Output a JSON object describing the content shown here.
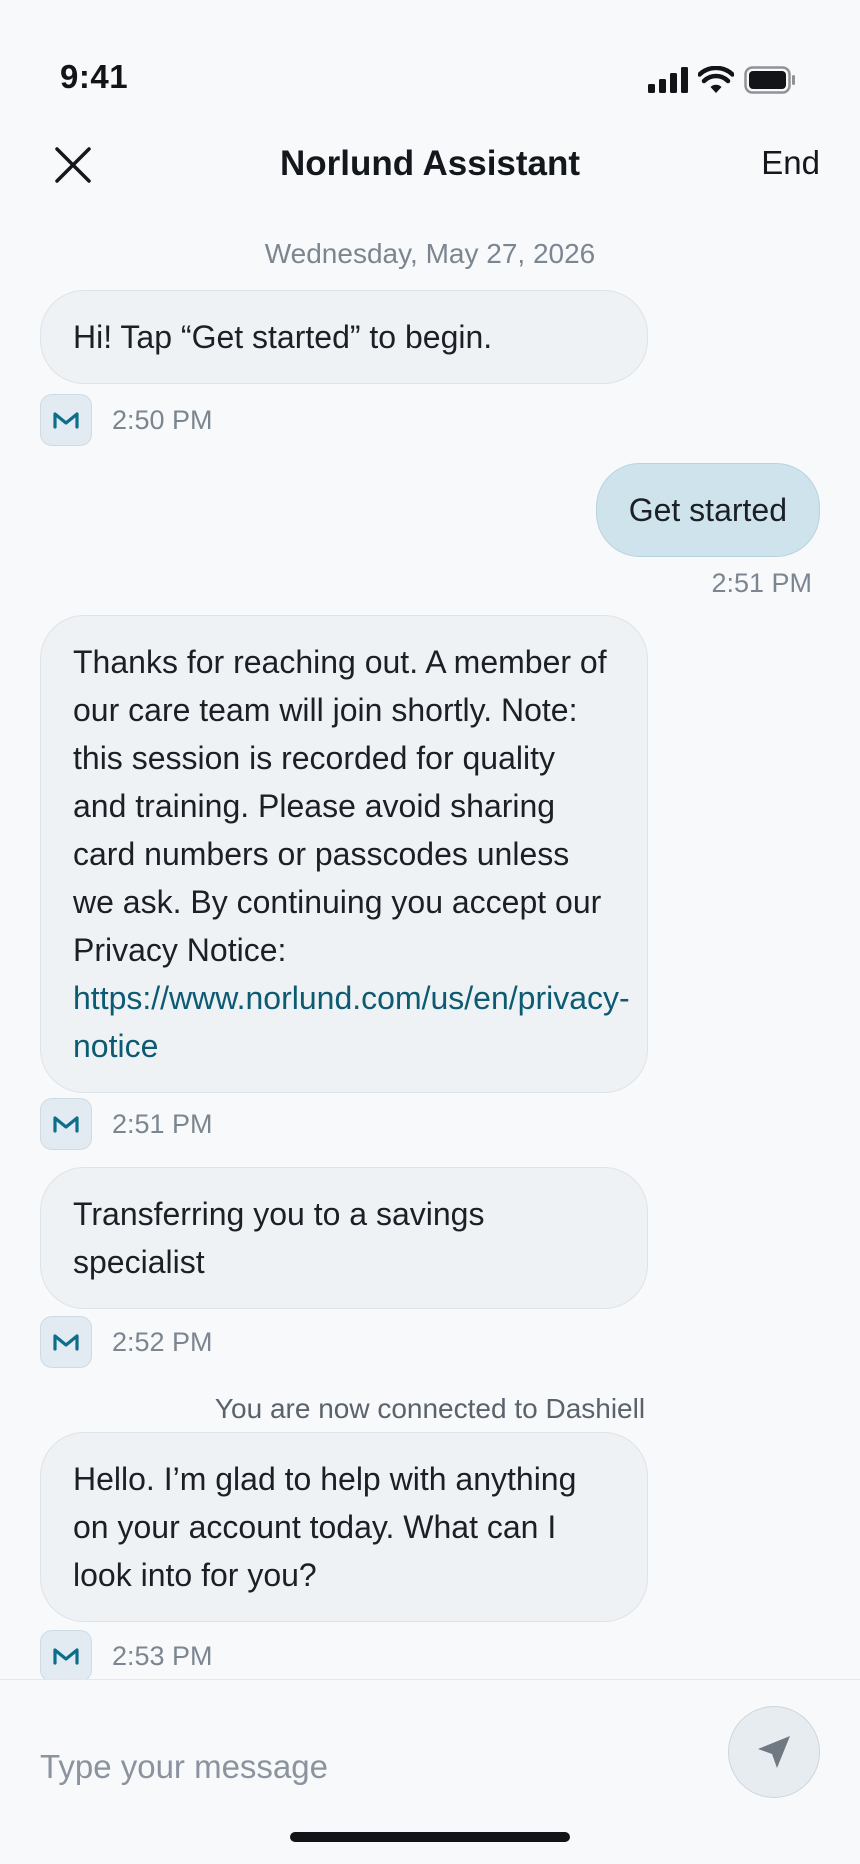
{
  "status_bar": {
    "time": "9:41",
    "icons": [
      "cellular-signal-icon",
      "wifi-icon",
      "battery-icon"
    ]
  },
  "header": {
    "close_icon": "close-icon",
    "title": "Norlund Assistant",
    "end_label": "End"
  },
  "chat": {
    "date": "Wednesday, May 27, 2026",
    "messages": [
      {
        "sender": "agent",
        "text": "Hi! Tap “Get started” to begin.",
        "time": "2:50 PM"
      },
      {
        "sender": "user",
        "text": "Get started",
        "time": "2:51 PM"
      },
      {
        "sender": "agent",
        "text": "Thanks for reaching out. A member of our care team will join shortly. Note: this session is recorded for quality and training. Please avoid sharing card numbers or passcodes unless we ask. By continuing you accept our Privacy Notice: ",
        "link": "https://www.norlund.com/us/en/privacy-notice",
        "time": "2:51 PM"
      },
      {
        "sender": "agent",
        "text": "Transferring you to a savings specialist",
        "time": "2:52 PM"
      },
      {
        "sender": "agent",
        "text": "Hello. I’m glad to help with anything on your account today. What can I look into for you?",
        "time": "2:53 PM"
      }
    ],
    "system_note": "You are now connected to Dashiell"
  },
  "composer": {
    "placeholder": "Type your message",
    "send_icon": "send-icon"
  },
  "colors": {
    "background": "#f7f9fb",
    "agent_bubble": "#eff2f4",
    "user_bubble": "#cfe3ec",
    "link": "#0d5a73",
    "brand_mark": "#0d6e8c"
  }
}
